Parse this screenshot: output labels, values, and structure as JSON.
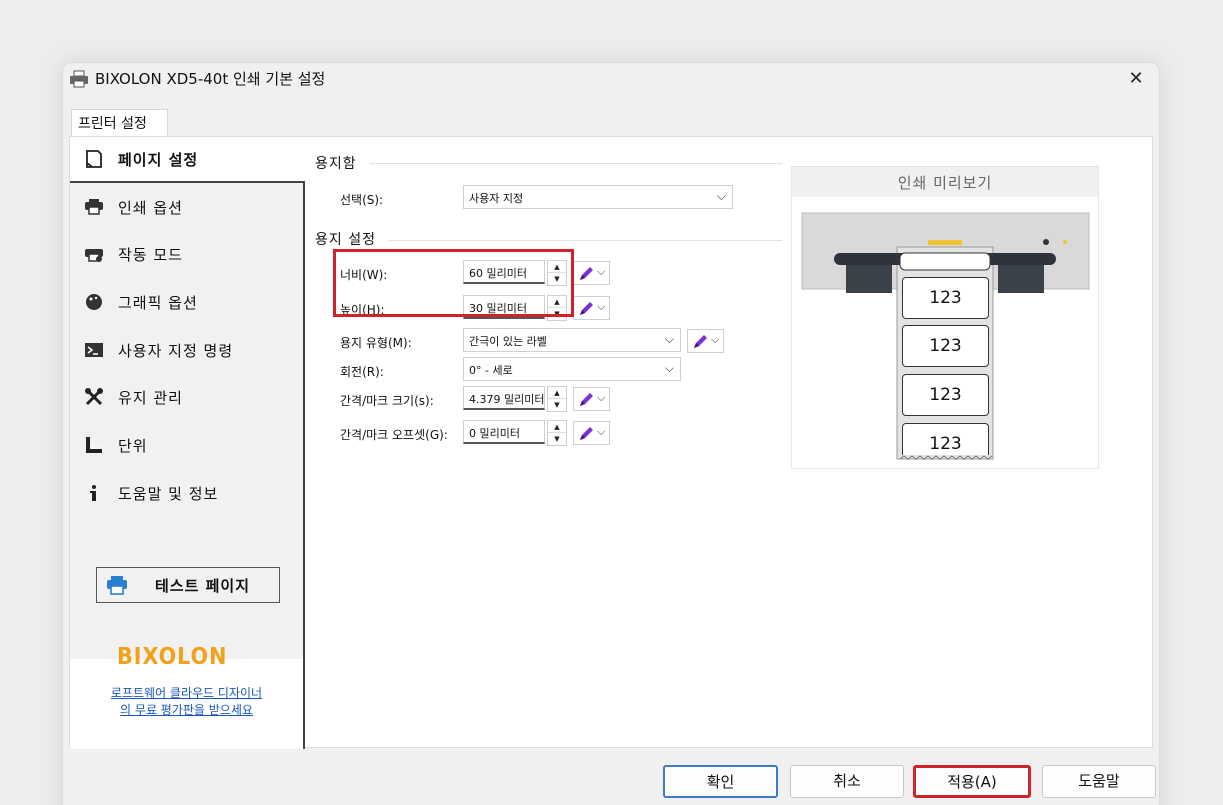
{
  "window": {
    "title": "BIXOLON XD5-40t 인쇄 기본 설정",
    "close_label": "✕"
  },
  "tab": {
    "label": "프린터 설정"
  },
  "sidebar": {
    "items": [
      {
        "label": "페이지 설정",
        "icon": "page-icon",
        "active": true
      },
      {
        "label": "인쇄 옵션",
        "icon": "printer-icon"
      },
      {
        "label": "작동 모드",
        "icon": "printer-mode-icon"
      },
      {
        "label": "그래픽 옵션",
        "icon": "palette-icon"
      },
      {
        "label": "사용자 지정 명령",
        "icon": "terminal-icon"
      },
      {
        "label": "유지 관리",
        "icon": "tools-icon"
      },
      {
        "label": "단위",
        "icon": "ruler-icon"
      },
      {
        "label": "도움말 및 정보",
        "icon": "info-icon"
      }
    ],
    "test_page_label": "테스트 페이지",
    "logo_text": "BIXOLON",
    "promo_line1": "로프트웨어 클라우드 디자이너",
    "promo_line2": "의 무료 평가판을 받으세요"
  },
  "paper_source": {
    "title": "용지함",
    "select_label": "선택(S):",
    "select_value": "사용자 지정"
  },
  "paper_settings": {
    "title": "용지 설정",
    "width_label": "너비(W):",
    "width_value": "60 밀리미터",
    "height_label": "높이(H):",
    "height_value": "30 밀리미터",
    "type_label": "용지 유형(M):",
    "type_value": "간극이 있는 라벨",
    "rotation_label": "회전(R):",
    "rotation_value": "0° - 세로",
    "gap_size_label": "간격/마크 크기(s):",
    "gap_size_value": "4.379 밀리미터",
    "gap_offset_label": "간격/마크 오프셋(G):",
    "gap_offset_value": "0 밀리미터"
  },
  "preview": {
    "title": "인쇄 미리보기",
    "labels": [
      "123",
      "123",
      "123",
      "123"
    ]
  },
  "buttons": {
    "ok": "확인",
    "cancel": "취소",
    "apply": "적용(A)",
    "help": "도움말"
  },
  "colors": {
    "highlight": "#d0222a",
    "logo": "#f2a11b",
    "link": "#1a56b8",
    "pen": "#7b2fd6"
  }
}
